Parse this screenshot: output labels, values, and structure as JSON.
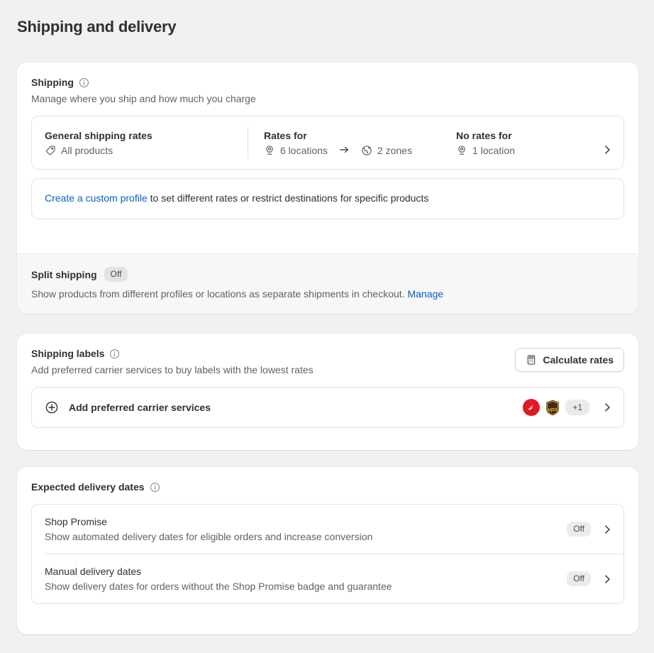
{
  "page": {
    "title": "Shipping and delivery"
  },
  "shipping": {
    "heading": "Shipping",
    "info_icon": "info-circle-icon",
    "subtitle": "Manage where you ship and how much you charge",
    "profile": {
      "name": "General shipping rates",
      "scope_icon": "tag-icon",
      "scope": "All products",
      "rates_for_label": "Rates for",
      "locations_icon": "location-pin-icon",
      "locations": "6 locations",
      "arrow_icon": "arrow-right-icon",
      "zones_icon": "globe-icon",
      "zones": "2 zones",
      "no_rates_label": "No rates for",
      "no_rates_icon": "location-pin-icon",
      "no_rates": "1 location",
      "chevron_icon": "chevron-right-icon"
    },
    "custom_profile": {
      "link_text": "Create a custom profile",
      "rest_text": " to set different rates or restrict destinations for specific products"
    },
    "split_shipping": {
      "title": "Split shipping",
      "badge": "Off",
      "description": "Show products from different profiles or locations as separate shipments in checkout.",
      "manage_link": "Manage"
    }
  },
  "shipping_labels": {
    "heading": "Shipping labels",
    "info_icon": "info-circle-icon",
    "subtitle": "Add preferred carrier services to buy labels with the lowest rates",
    "calculate_button": {
      "label": "Calculate rates",
      "icon": "calculator-icon"
    },
    "carrier_row": {
      "add_icon": "plus-circle-icon",
      "label": "Add preferred carrier services",
      "carriers": [
        "canada-post-logo",
        "ups-logo"
      ],
      "more_count": "+1",
      "chevron_icon": "chevron-right-icon"
    }
  },
  "expected_delivery_dates": {
    "heading": "Expected delivery dates",
    "info_icon": "info-circle-icon",
    "rows": [
      {
        "title": "Shop Promise",
        "subtitle": "Show automated delivery dates for eligible orders and increase conversion",
        "status": "Off",
        "chevron_icon": "chevron-right-icon"
      },
      {
        "title": "Manual delivery dates",
        "subtitle": "Show delivery dates for orders without the Shop Promise badge and guarantee",
        "status": "Off",
        "chevron_icon": "chevron-right-icon"
      }
    ]
  },
  "colors": {
    "page_background": "#f1f1f1",
    "card_background": "#ffffff",
    "footer_background": "#f7f7f7",
    "text_primary": "#303030",
    "text_secondary": "#616161",
    "link": "#0a5dc2",
    "border": "#e3e3e3",
    "badge_background": "#ebebeb",
    "canada_post_red": "#e01a22",
    "ups_brown": "#351c15",
    "ups_gold": "#ffb500"
  }
}
